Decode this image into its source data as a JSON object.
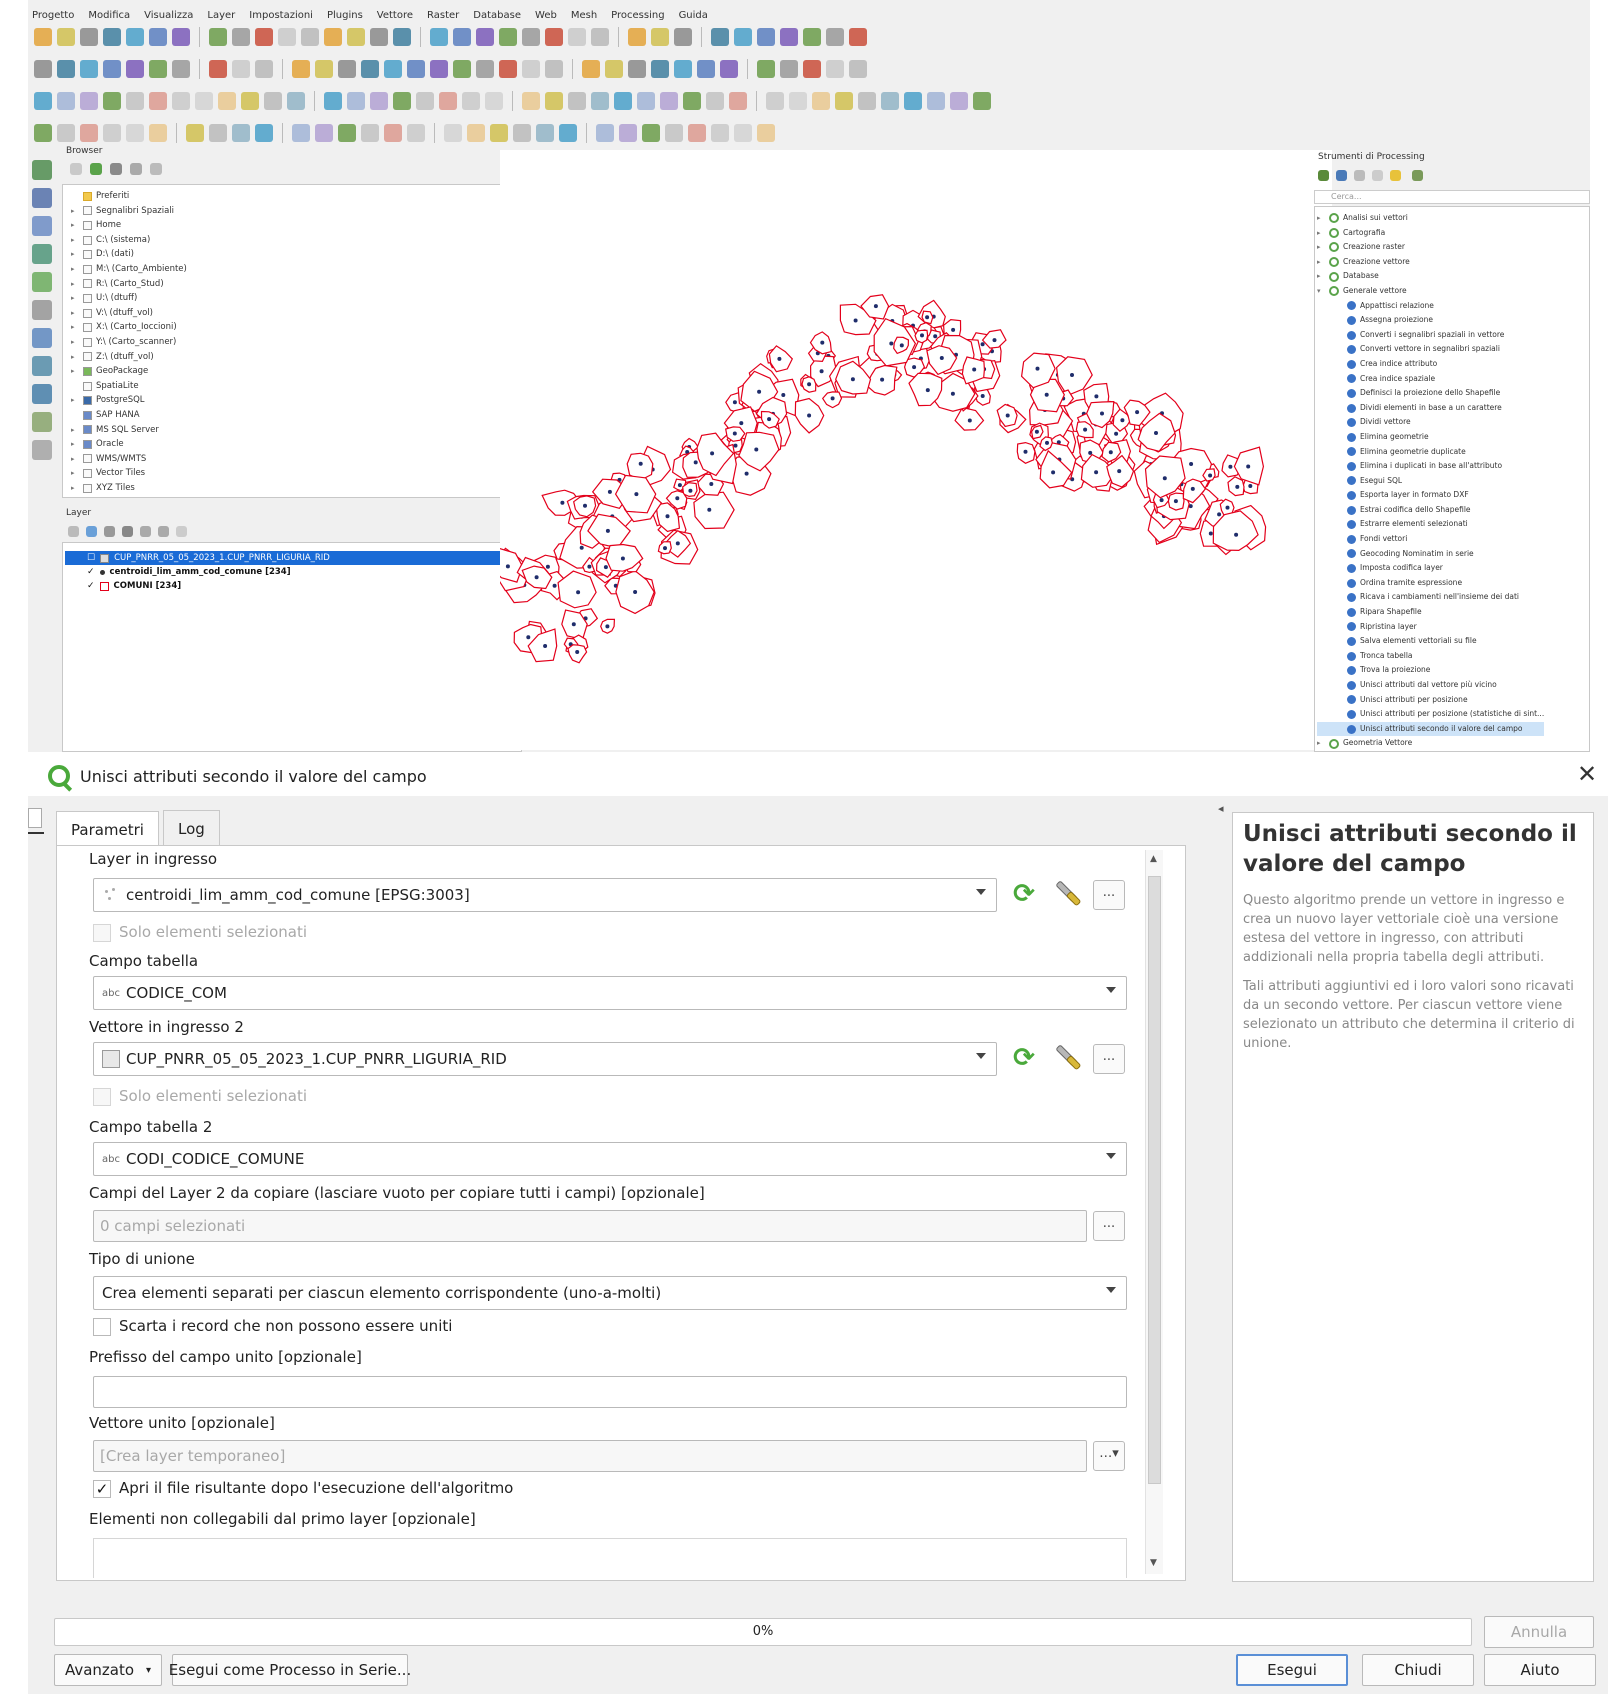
{
  "qgis": {
    "menu": [
      "Progetto",
      "Modifica",
      "Visualizza",
      "Layer",
      "Impostazioni",
      "Plugins",
      "Vettore",
      "Raster",
      "Database",
      "Web",
      "Mesh",
      "Processing",
      "Guida"
    ],
    "browser": {
      "title": "Browser",
      "items": [
        {
          "label": "Preferiti",
          "icon": "star-icon"
        },
        {
          "label": "Segnalibri Spaziali",
          "icon": "bookmark-icon"
        },
        {
          "label": "Home",
          "icon": "folder-icon"
        },
        {
          "label": "C:\\ (sistema)",
          "icon": "drive-icon"
        },
        {
          "label": "D:\\ (dati)",
          "icon": "drive-icon"
        },
        {
          "label": "M:\\ (Carto_Ambiente)",
          "icon": "drive-icon"
        },
        {
          "label": "R:\\ (Carto_Stud)",
          "icon": "drive-icon"
        },
        {
          "label": "U:\\ (dtuff)",
          "icon": "drive-icon"
        },
        {
          "label": "V:\\ (dtuff_vol)",
          "icon": "drive-icon"
        },
        {
          "label": "X:\\ (Carto_Ioccioni)",
          "icon": "drive-icon"
        },
        {
          "label": "Y:\\ (Carto_scanner)",
          "icon": "drive-icon"
        },
        {
          "label": "Z:\\ (dtuff_vol)",
          "icon": "drive-icon"
        },
        {
          "label": "GeoPackage",
          "icon": "geopackage-icon"
        },
        {
          "label": "SpatiaLite",
          "icon": "spatialite-icon"
        },
        {
          "label": "PostgreSQL",
          "icon": "postgresql-icon"
        },
        {
          "label": "SAP HANA",
          "icon": "database-icon"
        },
        {
          "label": "MS SQL Server",
          "icon": "database-icon"
        },
        {
          "label": "Oracle",
          "icon": "database-icon"
        },
        {
          "label": "WMS/WMTS",
          "icon": "wms-icon"
        },
        {
          "label": "Vector Tiles",
          "icon": "tiles-icon"
        },
        {
          "label": "XYZ Tiles",
          "icon": "tiles-icon"
        }
      ]
    },
    "layers": {
      "title": "Layer",
      "items": [
        {
          "label": "CUP_PNRR_05_05_2023_1.CUP_PNRR_LIGURIA_RID",
          "selected": true
        },
        {
          "label": "centroidi_lim_amm_cod_comune [234]",
          "selected": false
        },
        {
          "label": "COMUNI [234]",
          "selected": false
        }
      ]
    },
    "processing": {
      "title": "Strumenti di Processing",
      "search_placeholder": "Cerca...",
      "groups": [
        {
          "label": "Analisi sui vettori",
          "expanded": false
        },
        {
          "label": "Cartografia",
          "expanded": false
        },
        {
          "label": "Creazione raster",
          "expanded": false
        },
        {
          "label": "Creazione vettore",
          "expanded": false
        },
        {
          "label": "Database",
          "expanded": false
        },
        {
          "label": "Generale vettore",
          "expanded": true
        }
      ],
      "algorithms": [
        "Appattisci relazione",
        "Assegna proiezione",
        "Converti i segnalibri spaziali in vettore",
        "Converti vettore in segnalibri spaziali",
        "Crea indice attributo",
        "Crea indice spaziale",
        "Definisci la proiezione dello Shapefile",
        "Dividi elementi in base a un carattere",
        "Dividi vettore",
        "Elimina geometrie",
        "Elimina geometrie duplicate",
        "Elimina i duplicati in base all'attributo",
        "Esegui SQL",
        "Esporta layer in formato DXF",
        "Estrai codifica dello Shapefile",
        "Estrarre elementi selezionati",
        "Fondi vettori",
        "Geocoding Nominatim in serie",
        "Imposta codifica layer",
        "Ordina tramite espressione",
        "Ricava i cambiamenti nell'insieme dei dati",
        "Ripara Shapefile",
        "Ripristina layer",
        "Salva elementi vettoriali su file",
        "Tronca tabella",
        "Trova la proiezione",
        "Unisci attributi dal vettore più vicino",
        "Unisci attributi per posizione",
        "Unisci attributi per posizione (statistiche di sint...",
        "Unisci attributi secondo il valore del campo"
      ],
      "last_group": "Geometria Vettore"
    }
  },
  "dialog": {
    "title": "Unisci attributi secondo il valore del campo",
    "tabs": [
      "Parametri",
      "Log"
    ],
    "params": {
      "input_layer_label": "Layer in ingresso",
      "input_layer_value": "centroidi_lim_amm_cod_comune [EPSG:3003]",
      "selected_only_label": "Solo elementi selezionati",
      "table_field_label": "Campo tabella",
      "table_field_value": "CODICE_COM",
      "input_layer2_label": "Vettore in ingresso 2",
      "input_layer2_value": "CUP_PNRR_05_05_2023_1.CUP_PNRR_LIGURIA_RID",
      "selected_only2_label": "Solo elementi selezionati",
      "table_field2_label": "Campo tabella 2",
      "table_field2_value": "CODI_CODICE_COMUNE",
      "fields_to_copy_label": "Campi del Layer 2 da copiare (lasciare vuoto per copiare tutti i campi) [opzionale]",
      "fields_to_copy_value": "0 campi selezionati",
      "join_type_label": "Tipo di unione",
      "join_type_value": "Crea elementi separati per ciascun elemento corrispondente (uno-a-molti)",
      "discard_label": "Scarta i record che non possono essere uniti",
      "prefix_label": "Prefisso del campo unito [opzionale]",
      "prefix_value": "",
      "joined_layer_label": "Vettore unito [opzionale]",
      "joined_layer_placeholder": "[Crea layer temporaneo]",
      "open_file_label": "Apri il file risultante dopo l'esecuzione dell'algoritmo",
      "unjoinable_label": "Elementi non collegabili dal primo layer [opzionale]",
      "field_type_tag": "abc",
      "dots": "..."
    },
    "help": {
      "title": "Unisci attributi secondo il valore del campo",
      "p1": "Questo algoritmo prende un vettore in ingresso e crea un nuovo layer vettoriale cioè una versione estesa del vettore in ingresso, con attributi addizionali nella propria tabella degli attributi.",
      "p2": "Tali attributi aggiuntivi ed i loro valori sono ricavati da un secondo vettore. Per ciascun vettore viene selezionato un attributo che determina il criterio di unione."
    },
    "progress": {
      "value": 0,
      "label": "0%"
    },
    "buttons": {
      "cancel": "Annulla",
      "advanced": "Avanzato",
      "batch": "Esegui come Processo in Serie...",
      "run": "Esegui",
      "close": "Chiudi",
      "help": "Aiuto"
    }
  },
  "colors": {
    "accent": "#4aa93b",
    "map_outline": "#e3001b",
    "map_point": "#1f2d6b",
    "selection": "#1a6bd6"
  }
}
